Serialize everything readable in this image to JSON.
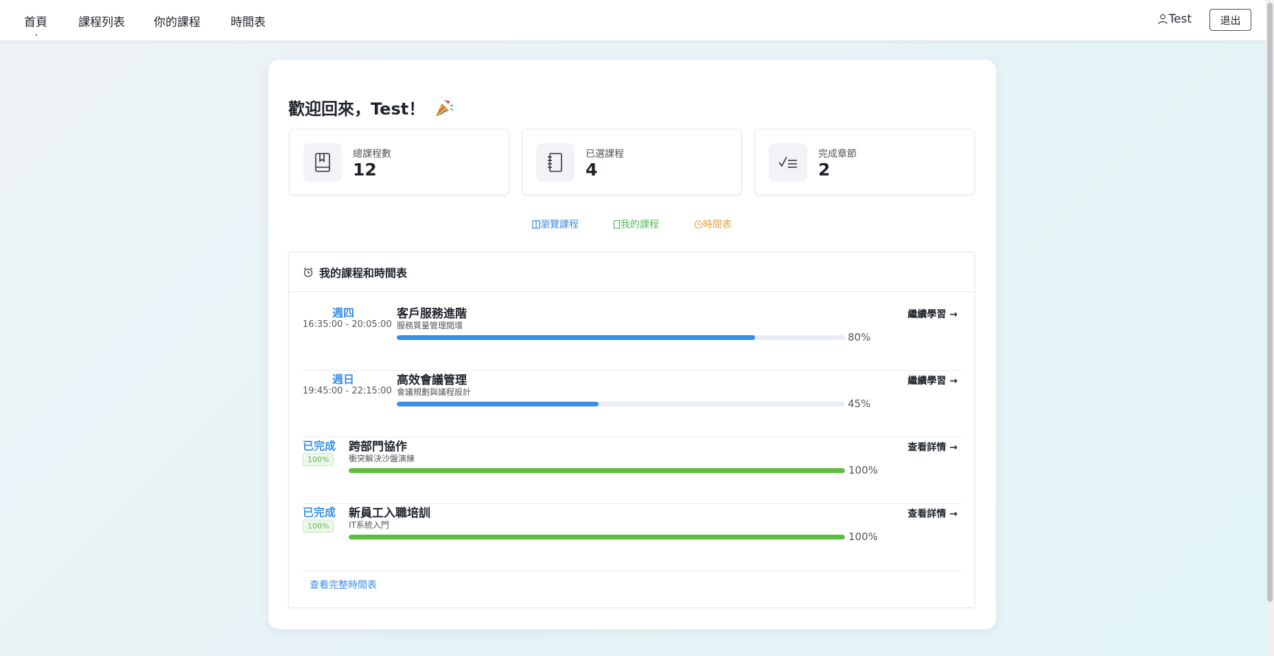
{
  "nav": {
    "items": [
      {
        "label": "首頁",
        "active": true
      },
      {
        "label": "課程列表",
        "active": false
      },
      {
        "label": "你的課程",
        "active": false
      },
      {
        "label": "時間表",
        "active": false
      }
    ],
    "user_name": "Test",
    "logout_label": "退出"
  },
  "welcome": {
    "text": "歡迎回來，Test！",
    "emoji_icon": "party-popper-icon"
  },
  "stats": [
    {
      "label": "總課程數",
      "value": "12",
      "icon": "book-icon"
    },
    {
      "label": "已選課程",
      "value": "4",
      "icon": "notebook-icon"
    },
    {
      "label": "完成章節",
      "value": "2",
      "icon": "checklist-icon"
    }
  ],
  "quick_links": [
    {
      "label": "瀏覽課程",
      "color": "#3a8ee6",
      "icon": "book-open-icon"
    },
    {
      "label": "我的課程",
      "color": "#5cb85c",
      "icon": "notebook-icon"
    },
    {
      "label": "時間表",
      "color": "#e6a23c",
      "icon": "clock-icon"
    }
  ],
  "schedule": {
    "title": "我的課程和時間表",
    "rows": [
      {
        "day": "週四",
        "time": "16:35:00 - 20:05:00",
        "title": "客戶服務進階",
        "subtitle": "服務質量管理閱環",
        "progress": 80,
        "progress_label": "80%",
        "action": "繼續學習 →",
        "completed": false
      },
      {
        "day": "週日",
        "time": "19:45:00 - 22:15:00",
        "title": "高效會議管理",
        "subtitle": "會議規劃與議程設計",
        "progress": 45,
        "progress_label": "45%",
        "action": "繼續學習 →",
        "completed": false
      },
      {
        "status": "已完成",
        "badge": "100%",
        "title": "跨部門協作",
        "subtitle": "衝突解決沙盤演練",
        "progress": 100,
        "progress_label": "100%",
        "action": "查看詳情 →",
        "completed": true
      },
      {
        "status": "已完成",
        "badge": "100%",
        "title": "新員工入職培訓",
        "subtitle": "IT系統入門",
        "progress": 100,
        "progress_label": "100%",
        "action": "查看詳情 →",
        "completed": true
      }
    ],
    "full_link": "查看完整時間表"
  },
  "colors": {
    "accent_blue": "#3a8ee6",
    "accent_green": "#5cb85c",
    "accent_orange": "#e6a23c"
  }
}
